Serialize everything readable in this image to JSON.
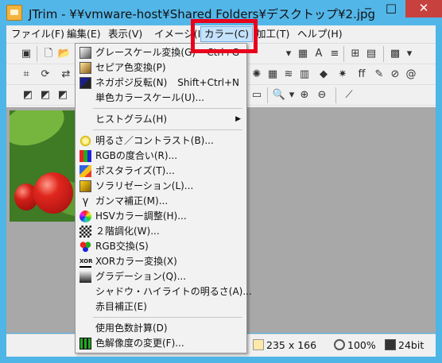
{
  "window": {
    "title": "JTrim - ¥¥vmware-host¥Shared Folders¥デスクトップ¥2.jpg",
    "minimize": "‒",
    "maximize": "□",
    "close": "✕"
  },
  "menubar": {
    "items": [
      {
        "label": "ファイル(F)"
      },
      {
        "label": "編集(E)"
      },
      {
        "label": "表示(V)"
      },
      {
        "label": "イメージ(I)"
      },
      {
        "label": "カラー(C)"
      },
      {
        "label": "加工(T)"
      },
      {
        "label": "ヘルプ(H)"
      }
    ],
    "active_index": 4
  },
  "color_menu": {
    "items": [
      {
        "label": "グレースケール変換(G)",
        "shortcut": "Ctrl+G",
        "icon": "grayscale-icon"
      },
      {
        "label": "セピア色変換(P)",
        "icon": "sepia-icon"
      },
      {
        "label": "ネガポジ反転(N)",
        "shortcut": "Shift+Ctrl+N",
        "icon": "negative-icon"
      },
      {
        "label": "単色カラースケール(U)..."
      },
      {
        "label": "ヒストグラム(H)",
        "submenu": true
      },
      {
        "label": "明るさ／コントラスト(B)...",
        "icon": "brightness-icon"
      },
      {
        "label": "RGBの度合い(R)...",
        "icon": "rgb-level-icon"
      },
      {
        "label": "ポスタライズ(T)...",
        "icon": "posterize-icon"
      },
      {
        "label": "ソラリゼーション(L)...",
        "icon": "solarization-icon"
      },
      {
        "label": "ガンマ補正(M)...",
        "icon": "gamma-icon"
      },
      {
        "label": "HSVカラー調整(H)...",
        "icon": "hsv-icon"
      },
      {
        "label": "２階調化(W)...",
        "icon": "binarize-icon"
      },
      {
        "label": "RGB交換(S)",
        "icon": "rgb-swap-icon"
      },
      {
        "label": "XORカラー変換(X)",
        "icon": "xor-icon"
      },
      {
        "label": "グラデーション(Q)...",
        "icon": "gradation-icon"
      },
      {
        "label": "シャドウ・ハイライトの明るさ(A)..."
      },
      {
        "label": "赤目補正(E)"
      },
      {
        "label": "使用色数計算(D)"
      },
      {
        "label": "色解像度の変更(F)...",
        "icon": "color-depth-icon"
      }
    ],
    "submenu_arrow": "▶"
  },
  "statusbar": {
    "dimensions": "235 x 166",
    "zoom": "100%",
    "bit_depth": "24bit"
  },
  "colors": {
    "title_bar": "#53b6e8",
    "close_button": "#c7413e",
    "highlight_frame": "#e8001c",
    "menu_active": "#c4e2fb"
  }
}
